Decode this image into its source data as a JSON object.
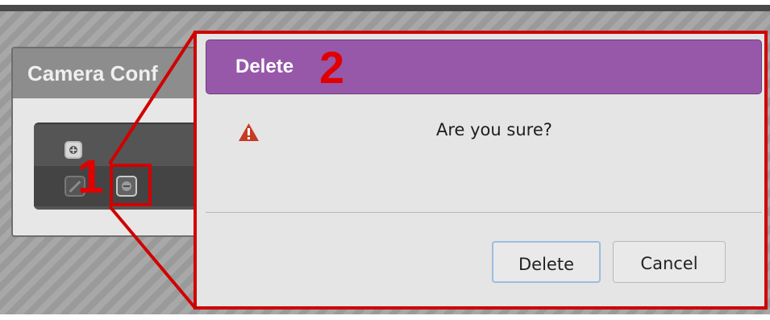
{
  "background_panel": {
    "title": "Camera Conf"
  },
  "annotations": {
    "step_one": "1",
    "step_two": "2",
    "accent_color": "#d10000"
  },
  "dialog": {
    "title": "Delete",
    "message": "Are you sure?",
    "warning_icon": "warning-triangle-icon",
    "buttons": {
      "delete_label": "Delete",
      "cancel_label": "Cancel"
    },
    "header_color": "#9758aa"
  },
  "icons": {
    "add": "plus-circle-icon",
    "edit": "edit-icon",
    "remove": "minus-circle-icon"
  }
}
